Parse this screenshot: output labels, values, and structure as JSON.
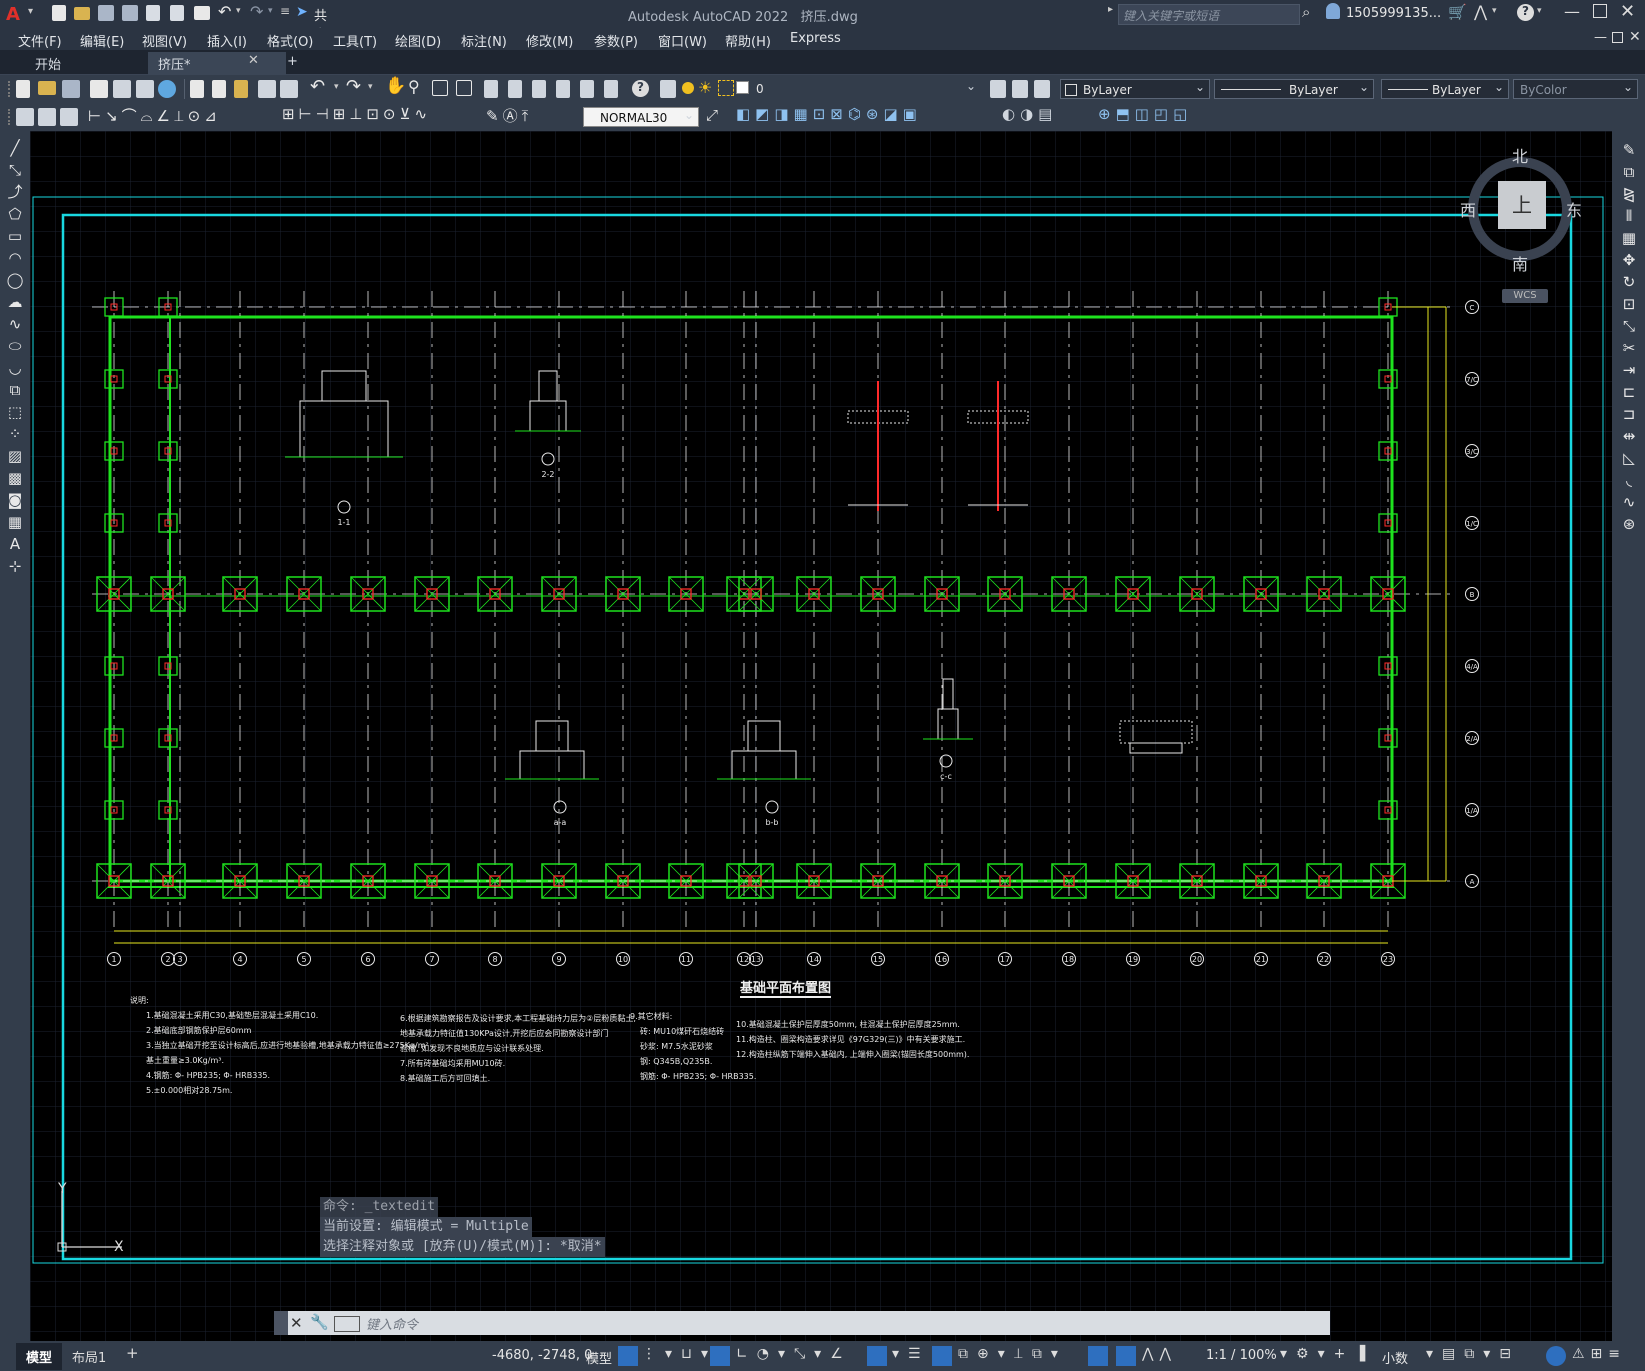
{
  "app": {
    "title": "Autodesk AutoCAD 2022",
    "file": "挤压.dwg",
    "share": "共享"
  },
  "search": {
    "placeholder": "键入关键字或短语",
    "user": "1505999135..."
  },
  "menu": [
    "文件(F)",
    "编辑(E)",
    "视图(V)",
    "插入(I)",
    "格式(O)",
    "工具(T)",
    "绘图(D)",
    "标注(N)",
    "修改(M)",
    "参数(P)",
    "窗口(W)",
    "帮助(H)",
    "Express"
  ],
  "tabs": {
    "start": "开始",
    "doc": "挤压*",
    "add": "+"
  },
  "layer": {
    "name": "0"
  },
  "props": {
    "color": "ByLayer",
    "linetype": "ByLayer",
    "lineweight": "ByLayer",
    "plot": "ByColor"
  },
  "style": {
    "text": "NORMAL30"
  },
  "viewcube": {
    "north": "北",
    "south": "南",
    "east": "东",
    "west": "西",
    "top": "上",
    "wcs": "WCS"
  },
  "drawing": {
    "title": "基础平面布置图",
    "axis_numbers": [
      "1",
      "2",
      "3",
      "4",
      "5",
      "6",
      "7",
      "8",
      "9",
      "10",
      "11",
      "12",
      "13",
      "14",
      "15",
      "16",
      "17",
      "18",
      "19",
      "20",
      "21",
      "22",
      "23"
    ],
    "axis_letters": [
      "C",
      "7/C",
      "3/C",
      "1/C",
      "B",
      "4/A",
      "2/A",
      "1/A",
      "A"
    ],
    "sections": [
      "1-1",
      "2-2",
      "a-a",
      "b-b",
      "c-c"
    ],
    "notes_title": "说明:",
    "notes_col1": [
      "1.基础混凝土采用C30,基础垫层混凝土采用C10.",
      "2.基础底部钢筋保护层60mm",
      "3.当独立基础开挖至设计标高后,应进行地基验槽,地基承载力特征值≥275Kg/m²",
      "基土重量≥3.0Kg/m³.",
      "4.钢筋: Φ- HPB235; Φ- HRB335.",
      "5.±0.000相对28.75m."
    ],
    "notes_col2": [
      "6.根据建筑勘察报告及设计要求,本工程基础持力层为②层粉质黏土,",
      "地基承载力特征值130KPa设计,开挖后应会同勘察设计部门",
      "验槽, 如发现不良地质应与设计联系处理.",
      "7.所有砖基础均采用MU10砖.",
      "8.基础施工后方可回填土."
    ],
    "notes_col3": [
      "9.其它材料:",
      "砖: MU10煤矸石烧结砖",
      "砂浆: M7.5水泥砂浆",
      "钢: Q345B,Q235B.",
      "钢筋: Φ- HPB235; Φ- HRB335."
    ],
    "notes_col4": [
      "10.基础混凝土保护层厚度50mm, 柱混凝土保护层厚度25mm.",
      "11.构造柱、圈梁构造要求详见《97G329(三)》中有关要求施工.",
      "12.构造柱纵筋下端伸入基础内, 上端伸入圈梁(锚固长度500mm)."
    ]
  },
  "command": {
    "history": [
      "命令: _textedit",
      "当前设置: 编辑模式 = Multiple",
      "选择注释对象或 [放弃(U)/模式(M)]: *取消*"
    ],
    "placeholder": "键入命令"
  },
  "ucs": {
    "x": "X",
    "y": "Y"
  },
  "status": {
    "layouts": [
      "模型",
      "布局1"
    ],
    "coords": "-4680, -2748, 0",
    "model": "模型",
    "scale": "1:1 / 100%",
    "units": "小数"
  },
  "colors": {
    "cyan": "#19d8e0",
    "green": "#1ee31e",
    "magenta": "#ff2cff",
    "red": "#ff2a2a",
    "yellow": "#e8e820",
    "white": "#e8e8e8"
  }
}
